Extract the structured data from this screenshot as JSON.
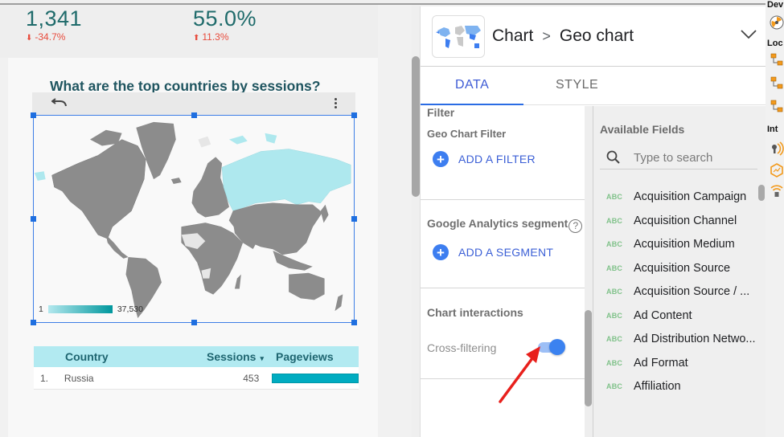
{
  "kpis": [
    {
      "value": "1,341",
      "delta": "-34.7%",
      "direction": "down"
    },
    {
      "value": "55.0%",
      "delta": "11.3%",
      "direction": "up"
    }
  ],
  "report": {
    "title": "What are the top countries by sessions?",
    "map": {
      "legend_min": "1",
      "legend_max": "37,530",
      "highlighted_country": "Russia",
      "colors": {
        "land": "#8c8c8c",
        "highlight": "#aee8ee",
        "no_data": "#e6e6e6",
        "scale_low": "#b3e8ee",
        "scale_high": "#00979d"
      }
    },
    "table": {
      "columns": [
        "Country",
        "Sessions",
        "Pageviews"
      ],
      "sort_indicator": "▾",
      "rows": [
        {
          "index": "1.",
          "country": "Russia",
          "sessions": "453",
          "pageviews_fraction": 1.0
        }
      ]
    }
  },
  "panel": {
    "breadcrumb_root": "Chart",
    "breadcrumb_separator": ">",
    "breadcrumb_current": "Geo chart",
    "tabs": [
      {
        "label": "DATA",
        "active": true
      },
      {
        "label": "STYLE",
        "active": false
      }
    ],
    "filter": {
      "heading": "Filter",
      "subheading": "Geo Chart Filter",
      "add_label": "ADD A FILTER"
    },
    "segment": {
      "heading": "Google Analytics segment",
      "help": "?",
      "add_label": "ADD A SEGMENT"
    },
    "interactions": {
      "heading": "Chart interactions",
      "cross_filter_label": "Cross-filtering",
      "cross_filter_on": true
    },
    "available_fields": {
      "heading": "Available Fields",
      "search_placeholder": "Type to search",
      "type_badge": "ABC",
      "fields": [
        "Acquisition Campaign",
        "Acquisition Channel",
        "Acquisition Medium",
        "Acquisition Source",
        "Acquisition Source / ...",
        "Ad Content",
        "Ad Distribution Netwo...",
        "Ad Format",
        "Affiliation"
      ]
    }
  },
  "right_strip": {
    "labels": [
      "Dev",
      "Loc",
      "Int"
    ]
  },
  "accent_colors": {
    "primary": "#3d7ef0",
    "annotation_arrow": "#e8201c"
  }
}
